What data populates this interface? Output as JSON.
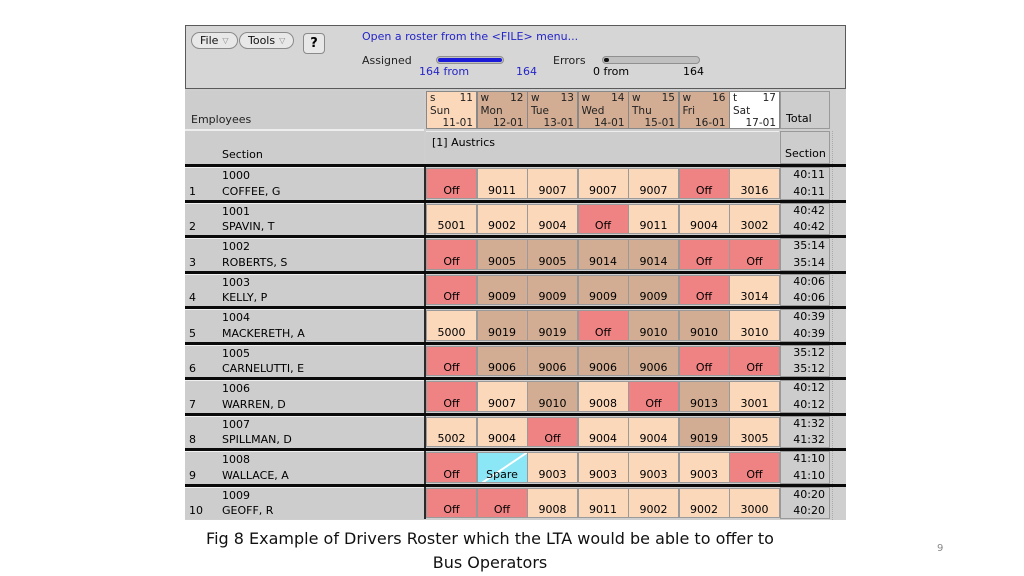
{
  "toolbar": {
    "file_menu": "File",
    "tools_menu": "Tools",
    "help_button": "?",
    "message": "Open a roster from the <FILE> menu...",
    "assigned_label": "Assigned",
    "assigned_count": "164 from",
    "assigned_total": "164",
    "assigned_fraction": 1.0,
    "errors_label": "Errors",
    "errors_count": "0 from",
    "errors_total": "164",
    "errors_fraction": 0.0
  },
  "header": {
    "employees_label": "Employees",
    "section_label": "Section",
    "section_name": "[1] Austrics",
    "total_label": "Total",
    "section_total_label": "Section",
    "days": [
      {
        "kind": "s",
        "num": "11",
        "day": "Sun",
        "date": "11-01",
        "color": "#fcd8bb"
      },
      {
        "kind": "w",
        "num": "12",
        "day": "Mon",
        "date": "12-01",
        "color": "#d2ad93"
      },
      {
        "kind": "w",
        "num": "13",
        "day": "Tue",
        "date": "13-01",
        "color": "#d2ad93"
      },
      {
        "kind": "w",
        "num": "14",
        "day": "Wed",
        "date": "14-01",
        "color": "#d2ad93"
      },
      {
        "kind": "w",
        "num": "15",
        "day": "Thu",
        "date": "15-01",
        "color": "#d2ad93"
      },
      {
        "kind": "w",
        "num": "16",
        "day": "Fri",
        "date": "16-01",
        "color": "#d2ad93"
      },
      {
        "kind": "t",
        "num": "17",
        "day": "Sat",
        "date": "17-01",
        "color": "#ffffff"
      }
    ]
  },
  "colors": {
    "off": "#ef8282",
    "light": "#fcd8bb",
    "tan": "#d2ad93",
    "spare": "#8be6f5",
    "accent_blue": "#2525c8"
  },
  "rows": [
    {
      "idx": "1",
      "id": "1000",
      "name": "COFFEE, G",
      "total1": "40:11",
      "total2": "40:11",
      "cells": [
        {
          "v": "Off",
          "t": "off"
        },
        {
          "v": "9011",
          "t": "light"
        },
        {
          "v": "9007",
          "t": "light"
        },
        {
          "v": "9007",
          "t": "light"
        },
        {
          "v": "9007",
          "t": "light"
        },
        {
          "v": "Off",
          "t": "off"
        },
        {
          "v": "3016",
          "t": "light"
        }
      ]
    },
    {
      "idx": "2",
      "id": "1001",
      "name": "SPAVIN, T",
      "total1": "40:42",
      "total2": "40:42",
      "cells": [
        {
          "v": "5001",
          "t": "light"
        },
        {
          "v": "9002",
          "t": "light"
        },
        {
          "v": "9004",
          "t": "light"
        },
        {
          "v": "Off",
          "t": "off"
        },
        {
          "v": "9011",
          "t": "light"
        },
        {
          "v": "9004",
          "t": "light"
        },
        {
          "v": "3002",
          "t": "light"
        }
      ]
    },
    {
      "idx": "3",
      "id": "1002",
      "name": "ROBERTS, S",
      "total1": "35:14",
      "total2": "35:14",
      "cells": [
        {
          "v": "Off",
          "t": "off"
        },
        {
          "v": "9005",
          "t": "tan"
        },
        {
          "v": "9005",
          "t": "tan"
        },
        {
          "v": "9014",
          "t": "tan"
        },
        {
          "v": "9014",
          "t": "tan"
        },
        {
          "v": "Off",
          "t": "off"
        },
        {
          "v": "Off",
          "t": "off"
        }
      ]
    },
    {
      "idx": "4",
      "id": "1003",
      "name": "KELLY, P",
      "total1": "40:06",
      "total2": "40:06",
      "cells": [
        {
          "v": "Off",
          "t": "off"
        },
        {
          "v": "9009",
          "t": "tan"
        },
        {
          "v": "9009",
          "t": "tan"
        },
        {
          "v": "9009",
          "t": "tan"
        },
        {
          "v": "9009",
          "t": "tan"
        },
        {
          "v": "Off",
          "t": "off"
        },
        {
          "v": "3014",
          "t": "light"
        }
      ]
    },
    {
      "idx": "5",
      "id": "1004",
      "name": "MACKERETH, A",
      "total1": "40:39",
      "total2": "40:39",
      "cells": [
        {
          "v": "5000",
          "t": "light"
        },
        {
          "v": "9019",
          "t": "tan"
        },
        {
          "v": "9019",
          "t": "tan"
        },
        {
          "v": "Off",
          "t": "off"
        },
        {
          "v": "9010",
          "t": "tan"
        },
        {
          "v": "9010",
          "t": "tan"
        },
        {
          "v": "3010",
          "t": "light"
        }
      ]
    },
    {
      "idx": "6",
      "id": "1005",
      "name": "CARNELUTTI, E",
      "total1": "35:12",
      "total2": "35:12",
      "cells": [
        {
          "v": "Off",
          "t": "off"
        },
        {
          "v": "9006",
          "t": "tan"
        },
        {
          "v": "9006",
          "t": "tan"
        },
        {
          "v": "9006",
          "t": "tan"
        },
        {
          "v": "9006",
          "t": "tan"
        },
        {
          "v": "Off",
          "t": "off"
        },
        {
          "v": "Off",
          "t": "off"
        }
      ]
    },
    {
      "idx": "7",
      "id": "1006",
      "name": "WARREN, D",
      "total1": "40:12",
      "total2": "40:12",
      "cells": [
        {
          "v": "Off",
          "t": "off"
        },
        {
          "v": "9007",
          "t": "light"
        },
        {
          "v": "9010",
          "t": "tan"
        },
        {
          "v": "9008",
          "t": "light"
        },
        {
          "v": "Off",
          "t": "off"
        },
        {
          "v": "9013",
          "t": "tan"
        },
        {
          "v": "3001",
          "t": "light"
        }
      ]
    },
    {
      "idx": "8",
      "id": "1007",
      "name": "SPILLMAN, D",
      "total1": "41:32",
      "total2": "41:32",
      "cells": [
        {
          "v": "5002",
          "t": "light"
        },
        {
          "v": "9004",
          "t": "light"
        },
        {
          "v": "Off",
          "t": "off"
        },
        {
          "v": "9004",
          "t": "light"
        },
        {
          "v": "9004",
          "t": "light"
        },
        {
          "v": "9019",
          "t": "tan"
        },
        {
          "v": "3005",
          "t": "light"
        }
      ]
    },
    {
      "idx": "9",
      "id": "1008",
      "name": "WALLACE, A",
      "total1": "41:10",
      "total2": "41:10",
      "cells": [
        {
          "v": "Off",
          "t": "off"
        },
        {
          "v": "Spare",
          "t": "spare"
        },
        {
          "v": "9003",
          "t": "light"
        },
        {
          "v": "9003",
          "t": "light"
        },
        {
          "v": "9003",
          "t": "light"
        },
        {
          "v": "9003",
          "t": "light"
        },
        {
          "v": "Off",
          "t": "off"
        }
      ]
    },
    {
      "idx": "10",
      "id": "1009",
      "name": "GEOFF, R",
      "total1": "40:20",
      "total2": "40:20",
      "cells": [
        {
          "v": "Off",
          "t": "off"
        },
        {
          "v": "Off",
          "t": "off"
        },
        {
          "v": "9008",
          "t": "light"
        },
        {
          "v": "9011",
          "t": "light"
        },
        {
          "v": "9002",
          "t": "light"
        },
        {
          "v": "9002",
          "t": "light"
        },
        {
          "v": "3000",
          "t": "light"
        }
      ]
    }
  ],
  "caption": {
    "line1": "Fig 8 Example of Drivers Roster which the LTA would be able to offer to",
    "line2": "Bus Operators"
  },
  "page_number": "9"
}
